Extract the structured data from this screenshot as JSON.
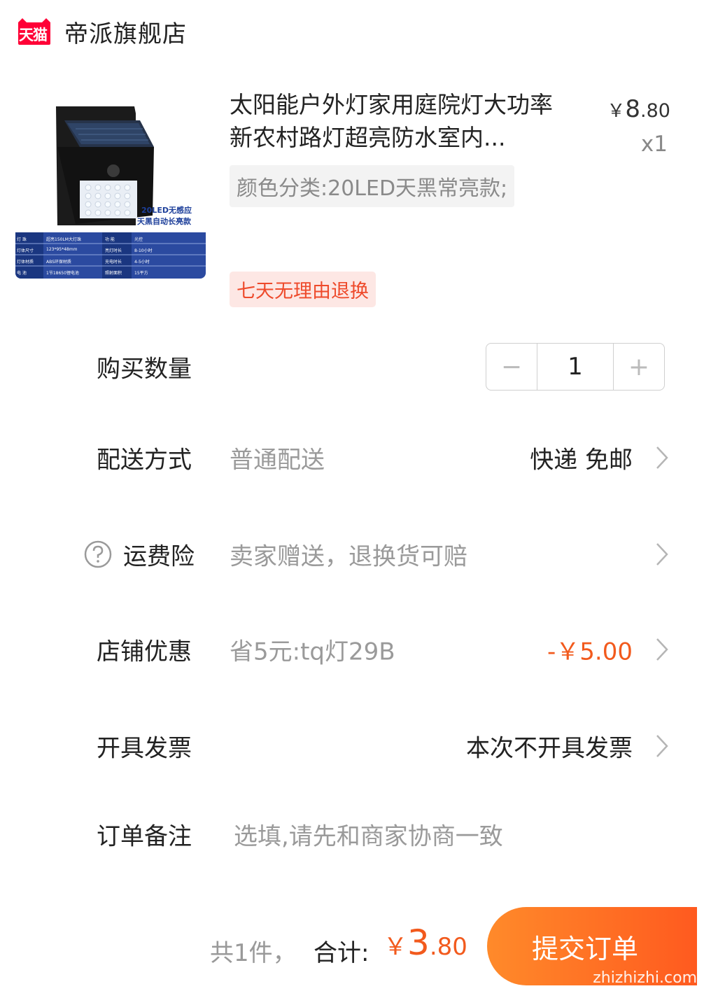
{
  "header": {
    "badge_text": "天猫",
    "store_name": "帝派旗舰店"
  },
  "product": {
    "title": "太阳能户外灯家用庭院灯大功率新农村路灯超亮防水室内...",
    "price_symbol": "￥",
    "price_int": "8",
    "price_dec": ".80",
    "quantity_x": "x1",
    "sku": "颜色分类:20LED天黑常亮款;",
    "tag": "七天无理由退换",
    "image": {
      "badge_line1": "20LED无感应",
      "badge_line2": "天黑自动长亮款",
      "specs": [
        [
          "灯 珠",
          "超亮150LM大灯珠",
          "功 能",
          "光控"
        ],
        [
          "灯体尺寸",
          "123*95*48mm",
          "亮灯时长",
          "8-10小时"
        ],
        [
          "灯体材质",
          "ABS环保材质",
          "充电时长",
          "4-5小时"
        ],
        [
          "电 池",
          "1节18650锂电池",
          "照射面积",
          "15平方"
        ]
      ]
    }
  },
  "quantity": {
    "label": "购买数量",
    "minus": "−",
    "value": "1",
    "plus": "+"
  },
  "delivery": {
    "label": "配送方式",
    "value": "普通配送",
    "right": "快递 免邮"
  },
  "insurance": {
    "label": "运费险",
    "value": "卖家赠送，退换货可赔",
    "icon": "question-circle-icon"
  },
  "coupon": {
    "label": "店铺优惠",
    "value": "省5元:tq灯29B",
    "right": "-￥5.00"
  },
  "invoice": {
    "label": "开具发票",
    "right": "本次不开具发票"
  },
  "remark": {
    "label": "订单备注",
    "placeholder": "选填,请先和商家协商一致"
  },
  "footer": {
    "count": "共1件，",
    "total_label": "合计:",
    "total_symbol": "￥",
    "total_int": "3",
    "total_dec": ".80",
    "submit": "提交订单",
    "watermark": "zhizhizhi.com"
  },
  "colors": {
    "accent": "#f25a1d",
    "tmall_red": "#ff0036"
  }
}
